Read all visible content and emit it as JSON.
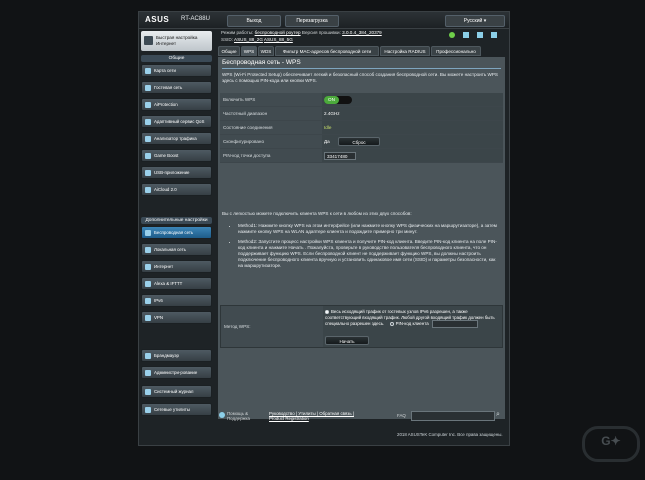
{
  "header": {
    "brand": "ASUS",
    "model": "RT-AC88U",
    "logout": "Выход",
    "reboot": "Перезагрузка",
    "language": "Русский"
  },
  "infobar": {
    "mode_label": "Режим работы:",
    "mode_value": "беспроводной роутер",
    "fw_label": "Версия прошивки:",
    "fw_value": "3.0.0.4_384_20379",
    "ssid_label": "SSID:",
    "ssid_1": "ASUS_88_2G",
    "ssid_2": "ASUS_88_5G"
  },
  "sidebar": {
    "quick_setup": "Быстрая настройка Интернет",
    "general_title": "Общие",
    "general_items": [
      {
        "label": "Карта сети",
        "icon": "network-map-icon"
      },
      {
        "label": "Гостевая сеть",
        "icon": "guest-network-icon"
      },
      {
        "label": "AiProtection",
        "icon": "shield-icon"
      },
      {
        "label": "Адаптивный сервис QoS",
        "icon": "qos-icon"
      },
      {
        "label": "Анализатор трафика",
        "icon": "traffic-analyzer-icon"
      },
      {
        "label": "Game Boost",
        "icon": "game-icon"
      },
      {
        "label": "USB-приложение",
        "icon": "usb-icon"
      },
      {
        "label": "AiCloud 2.0",
        "icon": "cloud-icon"
      }
    ],
    "advanced_title": "Дополнительные настройки",
    "advanced_items": [
      {
        "label": "Беспроводная сеть",
        "icon": "wireless-icon",
        "active": true
      },
      {
        "label": "Локальная сеть",
        "icon": "lan-icon"
      },
      {
        "label": "Интернет",
        "icon": "globe-icon"
      },
      {
        "label": "Alexa & IFTTT",
        "icon": "alexa-icon"
      },
      {
        "label": "IPv6",
        "icon": "ipv6-icon"
      },
      {
        "label": "VPN",
        "icon": "vpn-icon"
      },
      {
        "label": "Брандмауэр",
        "icon": "firewall-icon"
      },
      {
        "label": "Администри-рование",
        "icon": "admin-icon"
      },
      {
        "label": "Системный журнал",
        "icon": "log-icon"
      },
      {
        "label": "Сетевые утилиты",
        "icon": "tools-icon"
      }
    ]
  },
  "tabs": [
    "Общие",
    "WPS",
    "WDS",
    "Фильтр MAC-адресов беспроводной сети",
    "Настройка RADIUS",
    "Профессионально"
  ],
  "page": {
    "title": "Беспроводная сеть - WPS",
    "description": "WPS (Wi-Fi Protected Setup) обеспечивает легкий и безопасный способ создания беспроводной сети. Вы можете настроить WPS здесь с помощью PIN-кода или кнопки WPS.",
    "rows": [
      {
        "label": "Включить WPS",
        "value": "ON"
      },
      {
        "label": "Частотный диапазон",
        "value": "2.4GHz"
      },
      {
        "label": "Состояние соединения",
        "value": "Idle"
      },
      {
        "label": "Сконфигурировано",
        "value": "Да"
      },
      {
        "label": "PIN-код точки доступа",
        "value": "33417480"
      }
    ],
    "reset_button": "Сброс",
    "connect_intro": "Вы с легкостью можете подключить клиента WPS к сети в любом из этих двух способов:",
    "method1": "Method1: Нажмите кнопку WPS на этом интерфейсе (или нажмите кнопку WPS физических на маршрутизаторе), а затем нажмите кнопку WPS на WLAN адаптере клиента и подождите примерно три минут.",
    "method2": "Method2: Запустите процесс настройки WPS клиента и получите PIN-код клиента. Введите PIN-код клиента на поле PIN-код клиента и нажмите Начать . Пожалуйста, проверьте в руководстве пользователя беспроводного клиента, что он поддерживает функцию WPS. Если беспроводной клиент не поддерживает функцию WPS, вы должны настроить подключение беспроводного клиента вручную и установить одинаковое имя сети (SSID) и параметры безопасности, как на маршрутизаторе.",
    "method_label": "Метод WPS:",
    "push_button_text": "Весь исходящий трафик от гостевых узлов IPv6 разрешен, а также соответствующий входящий трафик. Любой другой входящий трафик должен быть специально разрешен здесь.",
    "pin_option": "PIN-код клиента",
    "start_button": "Начать"
  },
  "footer": {
    "help": "Помощь & Поддержка",
    "links": "Руководство | Утилиты | Обратная связь | Product Registration",
    "faq": "FAQ"
  },
  "copyright": "2018 ASUSTeK Computer Inc. Все права защищены."
}
